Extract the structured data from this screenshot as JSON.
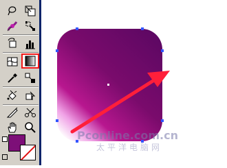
{
  "toolbox": {
    "tools": [
      {
        "name": "lasso-icon"
      },
      {
        "name": "scale-icon"
      },
      {
        "name": "mesh-icon"
      },
      {
        "name": "subselect-icon"
      },
      {
        "name": "rotate-icon"
      },
      {
        "name": "graph-icon"
      },
      {
        "name": "gradient-mesh-icon"
      },
      {
        "name": "gradient-icon",
        "active": true
      },
      {
        "name": "eyedropper-icon"
      },
      {
        "name": "blend-icon"
      },
      {
        "name": "paint-bucket-icon"
      },
      {
        "name": "transform-icon"
      },
      {
        "name": "slice-icon"
      },
      {
        "name": "scissors-icon"
      },
      {
        "name": "hand-icon"
      },
      {
        "name": "zoom-icon"
      }
    ],
    "fill_color": "#7d0f78",
    "stroke_color": "none"
  },
  "canvas": {
    "shape": "rounded-rectangle",
    "gradient_colors": [
      "#ffffff",
      "#f0a2e6",
      "#b8178f",
      "#7a0b6c",
      "#5d0863"
    ],
    "arrow_color": "#ff1f3a"
  },
  "watermark": {
    "text": "Pconline.com.cn",
    "text_cn": "太平洋电脑网"
  }
}
